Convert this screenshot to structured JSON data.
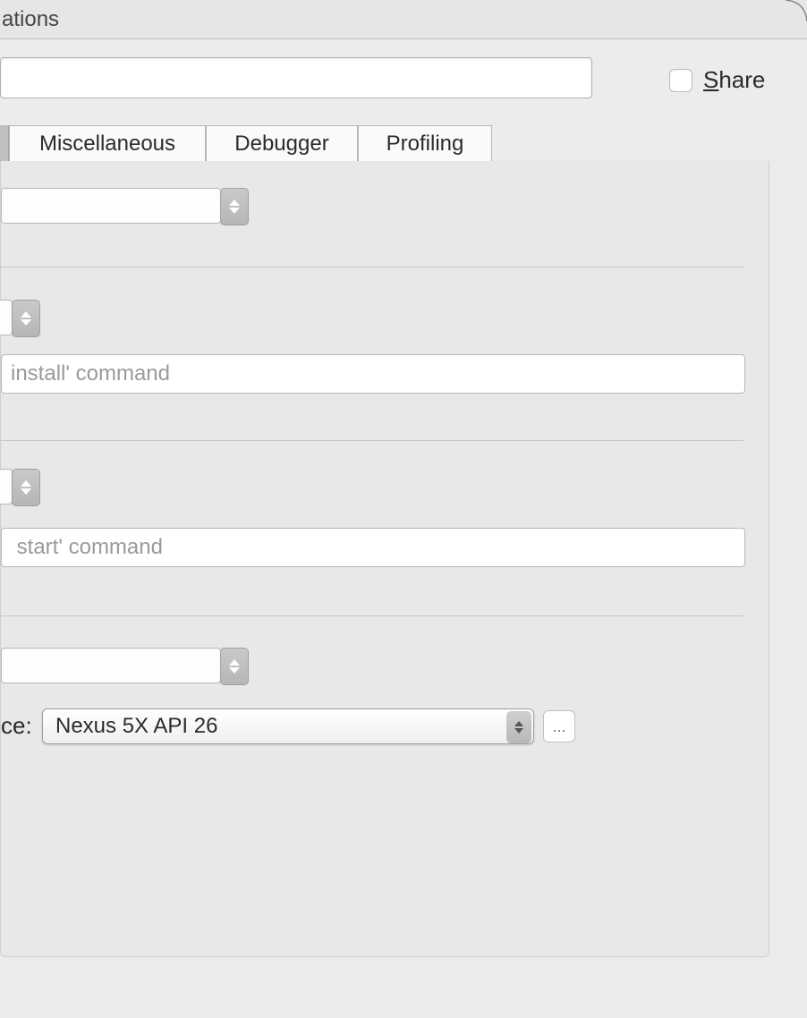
{
  "header": {
    "title_fragment": "ations"
  },
  "share": {
    "label": "Share",
    "checked": false
  },
  "tabs": [
    {
      "label": "Miscellaneous"
    },
    {
      "label": "Debugger"
    },
    {
      "label": "Profiling"
    }
  ],
  "inputs": {
    "install_placeholder": "install' command",
    "start_placeholder": " start' command"
  },
  "device": {
    "label_fragment": "ce:",
    "selected": "Nexus 5X API 26",
    "browse": "..."
  }
}
